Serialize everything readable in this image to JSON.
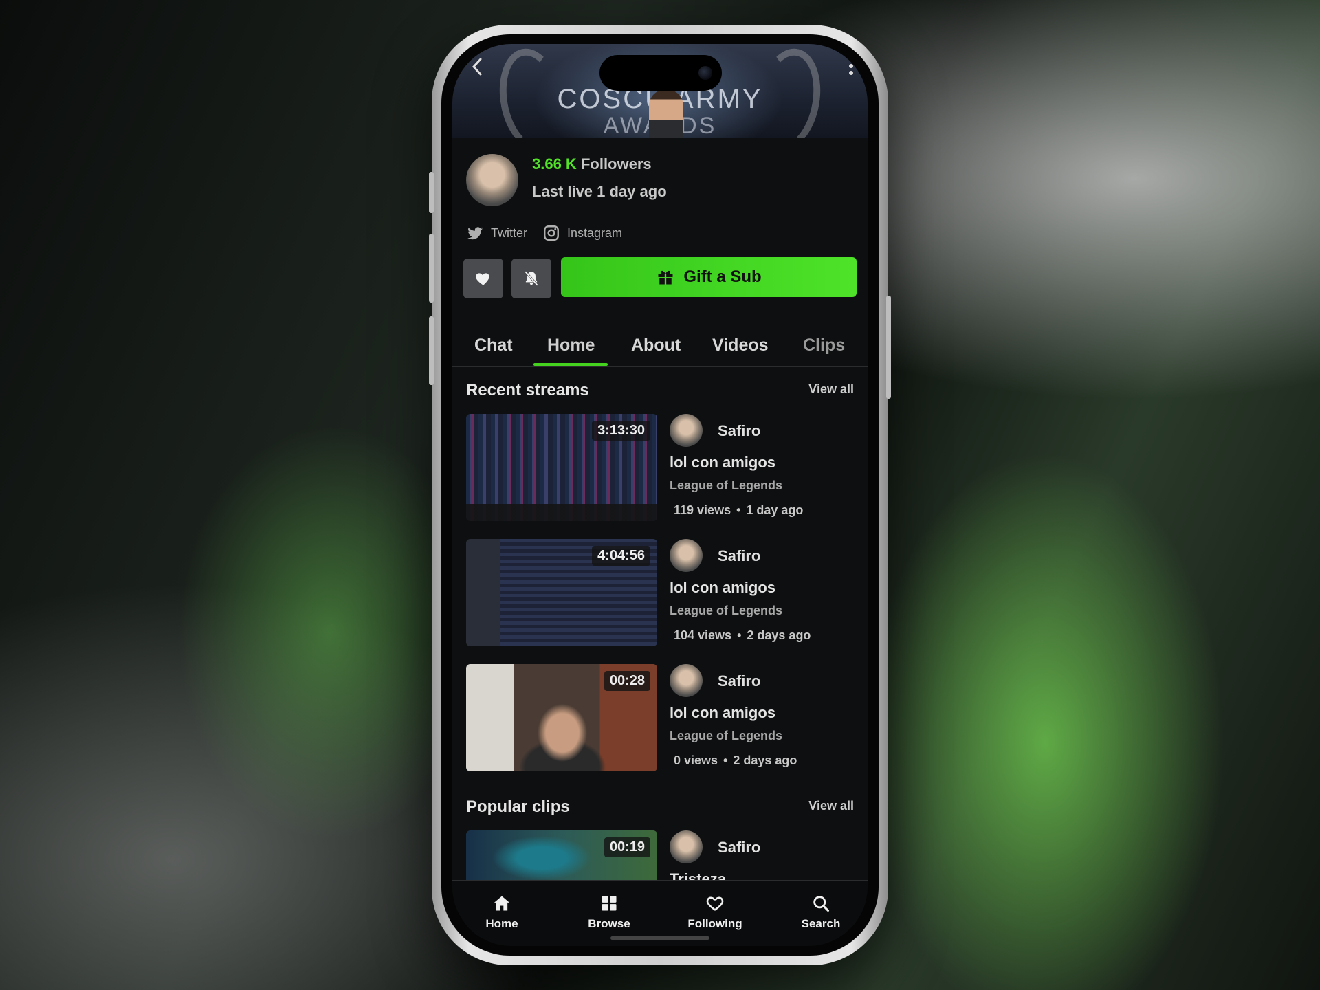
{
  "colors": {
    "accent_green": "#4ee329",
    "background": "#0e0f10"
  },
  "banner": {
    "line1": "COSCU ARMY",
    "line2": "AWARDS"
  },
  "header": {
    "back_icon": "chevron-left-icon",
    "more_icon": "vertical-dots-icon"
  },
  "profile": {
    "followers_count": "3.66 K",
    "followers_label": "Followers",
    "last_live": "Last live 1 day ago",
    "socials": [
      {
        "label": "Twitter",
        "icon": "twitter-icon"
      },
      {
        "label": "Instagram",
        "icon": "instagram-icon"
      }
    ]
  },
  "actions": {
    "follow_icon": "heart-icon",
    "notifications_icon": "bell-off-icon",
    "gift_label": "Gift a Sub",
    "gift_icon": "gift-icon"
  },
  "tabs": [
    {
      "label": "Chat"
    },
    {
      "label": "Home",
      "active": true
    },
    {
      "label": "About"
    },
    {
      "label": "Videos"
    },
    {
      "label": "Clips"
    }
  ],
  "recent_streams": {
    "title": "Recent streams",
    "view_all": "View all",
    "items": [
      {
        "duration": "3:13:30",
        "channel": "Safiro",
        "title": "lol con amigos",
        "category": "League of Legends",
        "views": "119 views",
        "age": "1 day ago"
      },
      {
        "duration": "4:04:56",
        "channel": "Safiro",
        "title": "lol con amigos",
        "category": "League of Legends",
        "views": "104 views",
        "age": "2 days ago"
      },
      {
        "duration": "00:28",
        "channel": "Safiro",
        "title": "lol con amigos",
        "category": "League of Legends",
        "views": "0 views",
        "age": "2 days ago"
      }
    ]
  },
  "popular_clips": {
    "title": "Popular clips",
    "view_all": "View all",
    "items": [
      {
        "duration": "00:19",
        "channel": "Safiro",
        "title": "Tristeza"
      }
    ]
  },
  "separator": "•",
  "bottom_nav": [
    {
      "label": "Home",
      "icon": "home-icon"
    },
    {
      "label": "Browse",
      "icon": "grid-icon"
    },
    {
      "label": "Following",
      "icon": "heart-outline-icon"
    },
    {
      "label": "Search",
      "icon": "search-icon"
    }
  ]
}
